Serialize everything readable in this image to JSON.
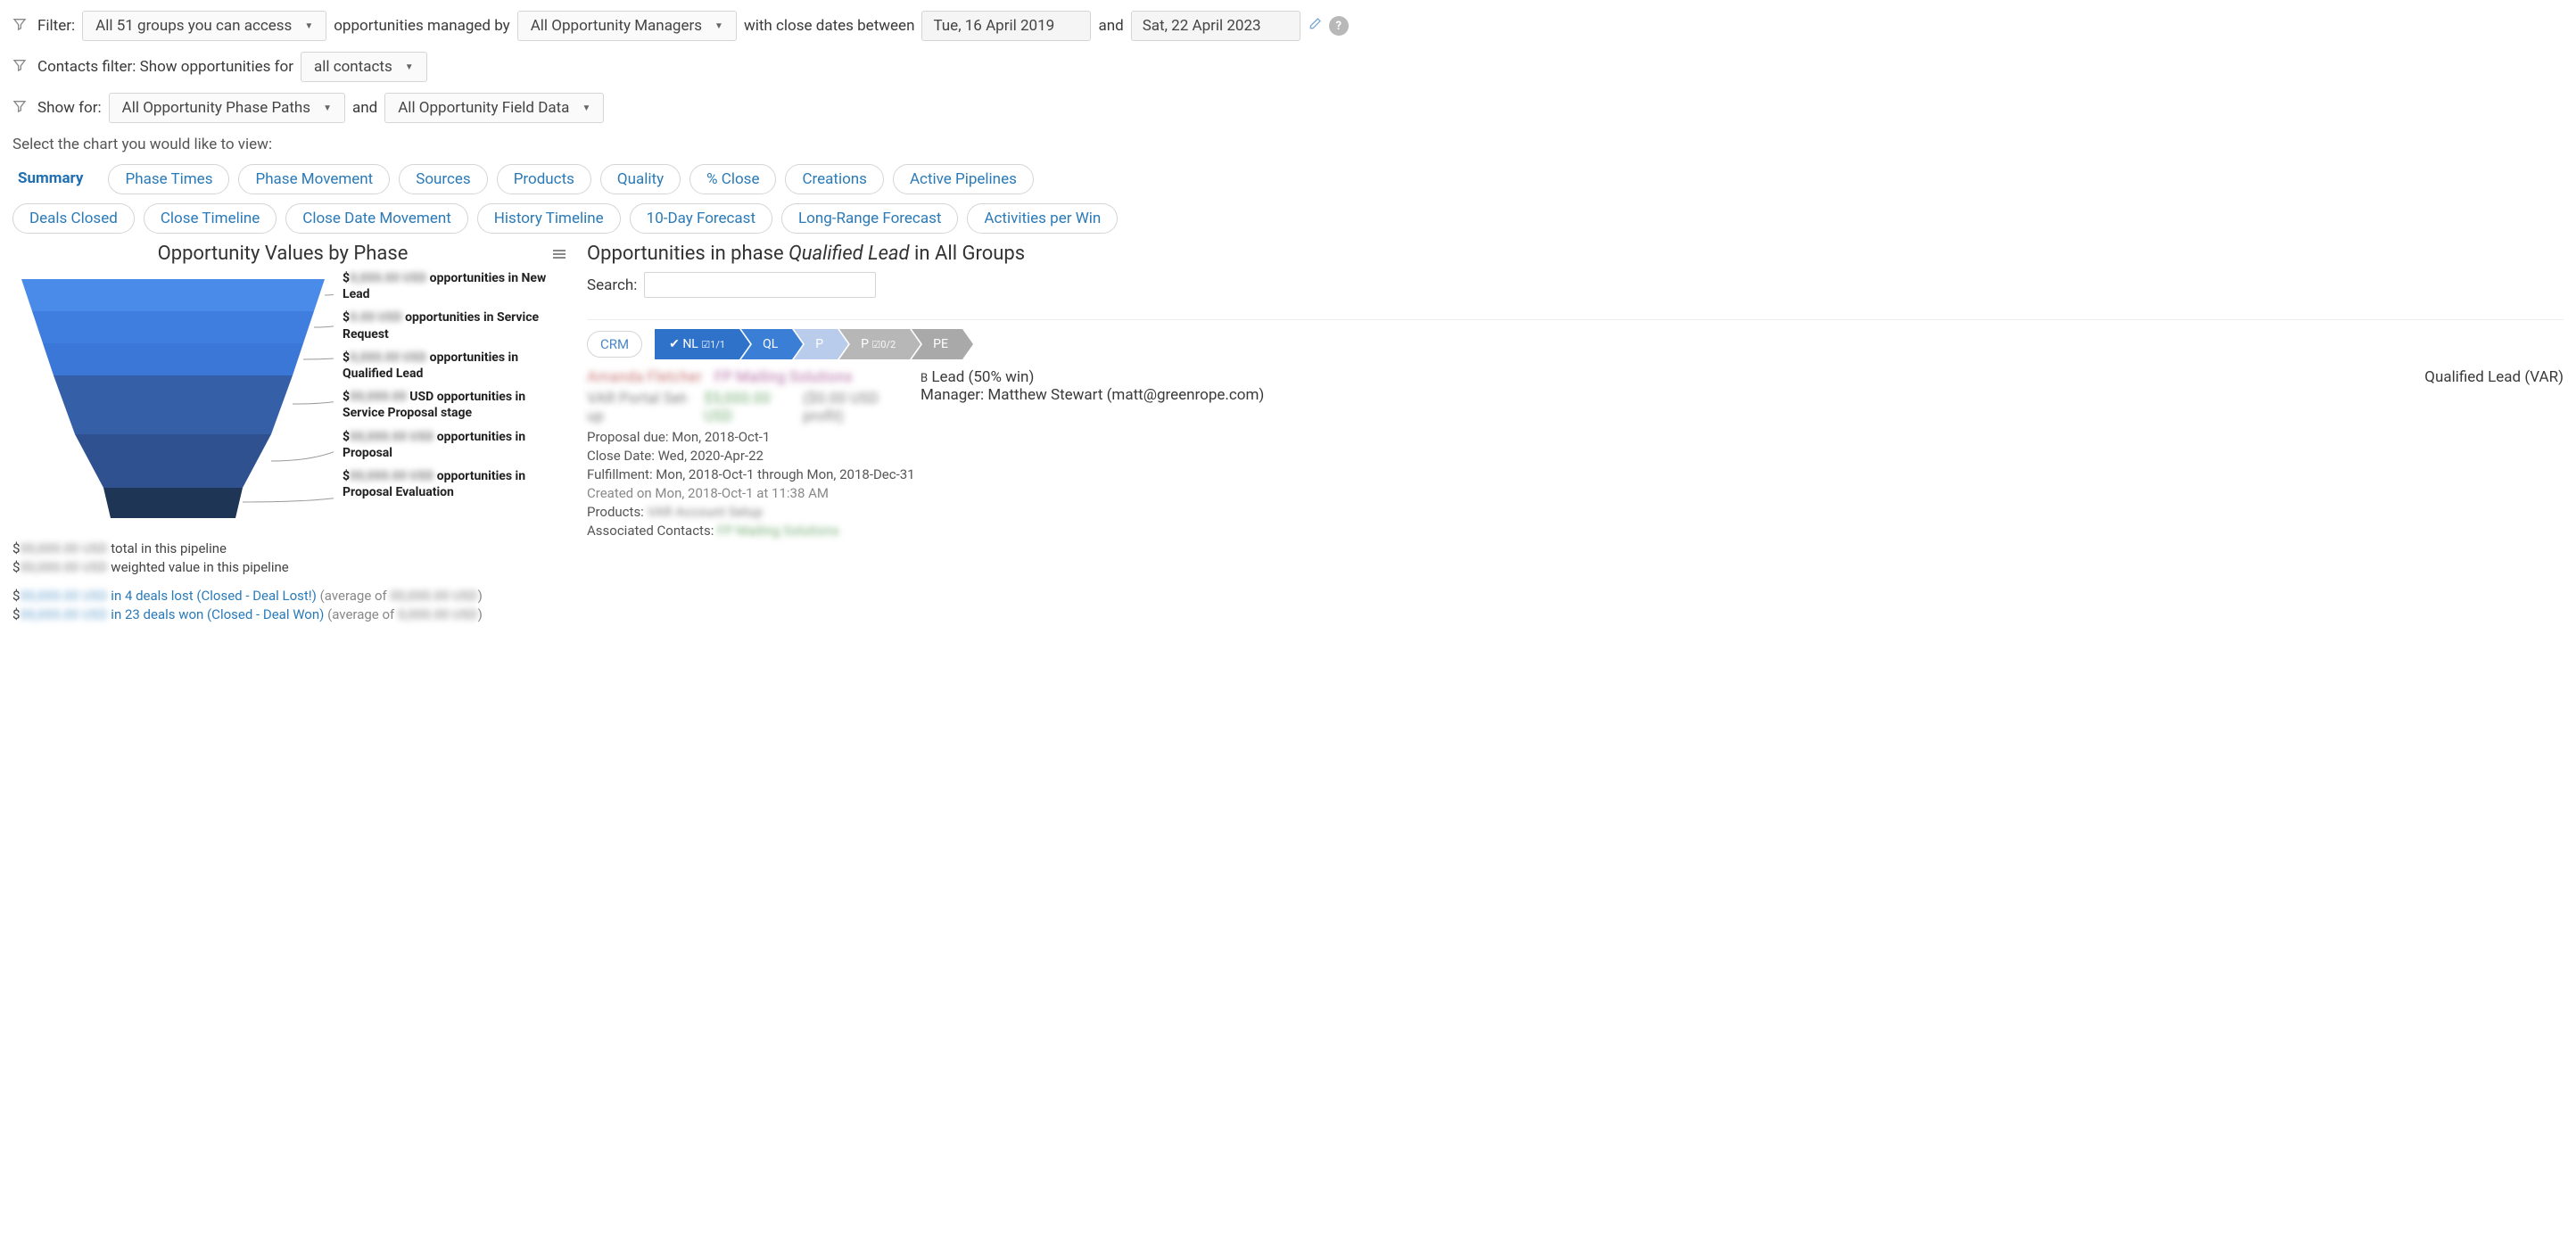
{
  "filters": {
    "filter_label": "Filter:",
    "groups": "All 51 groups you can access",
    "managed_by_text": "opportunities managed by",
    "managers": "All Opportunity Managers",
    "close_dates_text": "with close dates between",
    "date_from": "Tue, 16 April 2019",
    "and_text": "and",
    "date_to": "Sat, 22 April 2023",
    "contacts_filter_label": "Contacts filter: Show opportunities for",
    "contacts": "all contacts",
    "show_for_label": "Show for:",
    "phase_paths": "All Opportunity Phase Paths",
    "and_text2": "and",
    "field_data": "All Opportunity Field Data"
  },
  "chart_prompt": "Select the chart you would like to view:",
  "tabs_row1": [
    "Summary",
    "Phase Times",
    "Phase Movement",
    "Sources",
    "Products",
    "Quality",
    "% Close",
    "Creations",
    "Active Pipelines"
  ],
  "tabs_row2": [
    "Deals Closed",
    "Close Timeline",
    "Close Date Movement",
    "History Timeline",
    "10-Day Forecast",
    "Long-Range Forecast",
    "Activities per Win"
  ],
  "active_tab": "Summary",
  "chart_title": "Opportunity Values by Phase",
  "funnel_labels": [
    {
      "prefix": "$",
      "value": "0,000.00 USD",
      "suffix": "opportunities in New Lead"
    },
    {
      "prefix": "$",
      "value": "0.00 USD",
      "suffix": "opportunities in Service Request"
    },
    {
      "prefix": "$",
      "value": "0,000.00 USD",
      "suffix": "opportunities in Qualified Lead"
    },
    {
      "prefix": "$",
      "value": "00,000.00",
      "suffix": "USD opportunities in Service Proposal stage"
    },
    {
      "prefix": "$",
      "value": "00,000.00 USD",
      "suffix": "opportunities in Proposal"
    },
    {
      "prefix": "$",
      "value": "00,000.00 USD",
      "suffix": "opportunities in Proposal Evaluation"
    }
  ],
  "pipeline_stats": {
    "total_prefix": "$",
    "total_val": "00,000.00 USD",
    "total_suffix": "total in this pipeline",
    "weighted_prefix": "$",
    "weighted_val": "00,000.00 USD",
    "weighted_suffix": "weighted value in this pipeline",
    "lost_prefix": "$",
    "lost_val": "00,000.00 USD",
    "lost_link": "in 4 deals lost (Closed - Deal Lost!)",
    "lost_avg_label": "(average of",
    "lost_avg_val": "00,000.00 USD",
    "lost_close": ")",
    "won_prefix": "$",
    "won_val": "00,000.00 USD",
    "won_link": "in 23 deals won (Closed - Deal Won)",
    "won_avg_label": "(average of",
    "won_avg_val": "0,000.00 USD",
    "won_close": ")"
  },
  "detail": {
    "title_prefix": "Opportunities in phase ",
    "title_phase": "Qualified Lead",
    "title_suffix": " in All Groups",
    "search_label": "Search:",
    "crm_label": "CRM",
    "phases": [
      {
        "code": "NL",
        "extra": "☑1/1",
        "cls": "chev-blue1",
        "check": "✔"
      },
      {
        "code": "QL",
        "extra": "",
        "cls": "chev-blue2",
        "check": ""
      },
      {
        "code": "P",
        "extra": "",
        "cls": "chev-lite",
        "check": ""
      },
      {
        "code": "P",
        "extra": "☑0/2",
        "cls": "chev-grey",
        "check": ""
      },
      {
        "code": "PE",
        "extra": "",
        "cls": "chev-grey2",
        "check": ""
      }
    ],
    "contact_name": "Amanda Fletcher",
    "company": "FP Mailing Solutions",
    "task": "VAR Portal Set-up",
    "amount": "$5,000.00 USD",
    "profit": "($0.00 USD profit)",
    "lead_score": "B Lead (50% win)",
    "manager_label": "Manager:",
    "manager": "Matthew Stewart (matt@greenrope.com)",
    "phase_badge": "Qualified Lead (VAR)",
    "proposal_due": "Proposal due: Mon, 2018-Oct-1",
    "close_date": "Close Date: Wed, 2020-Apr-22",
    "fulfillment": "Fulfillment: Mon, 2018-Oct-1 through Mon, 2018-Dec-31",
    "created": "Created on Mon, 2018-Oct-1 at 11:38 AM",
    "products_label": "Products:",
    "products_val": "VAR Account Setup",
    "assoc_label": "Associated Contacts:",
    "assoc_val": "FP Mailing Solutions"
  },
  "chart_data": {
    "type": "bar",
    "note": "funnel — values redacted in source image, relative widths estimated",
    "categories": [
      "New Lead",
      "Service Request",
      "Qualified Lead",
      "Service Proposal stage",
      "Proposal",
      "Proposal Evaluation"
    ],
    "relative_widths": [
      100,
      92,
      84,
      72,
      52,
      40
    ],
    "colors": [
      "#4a8ae8",
      "#3f7ede",
      "#3a77d6",
      "#3560a8",
      "#2f5190",
      "#1e3556"
    ],
    "title": "Opportunity Values by Phase"
  }
}
